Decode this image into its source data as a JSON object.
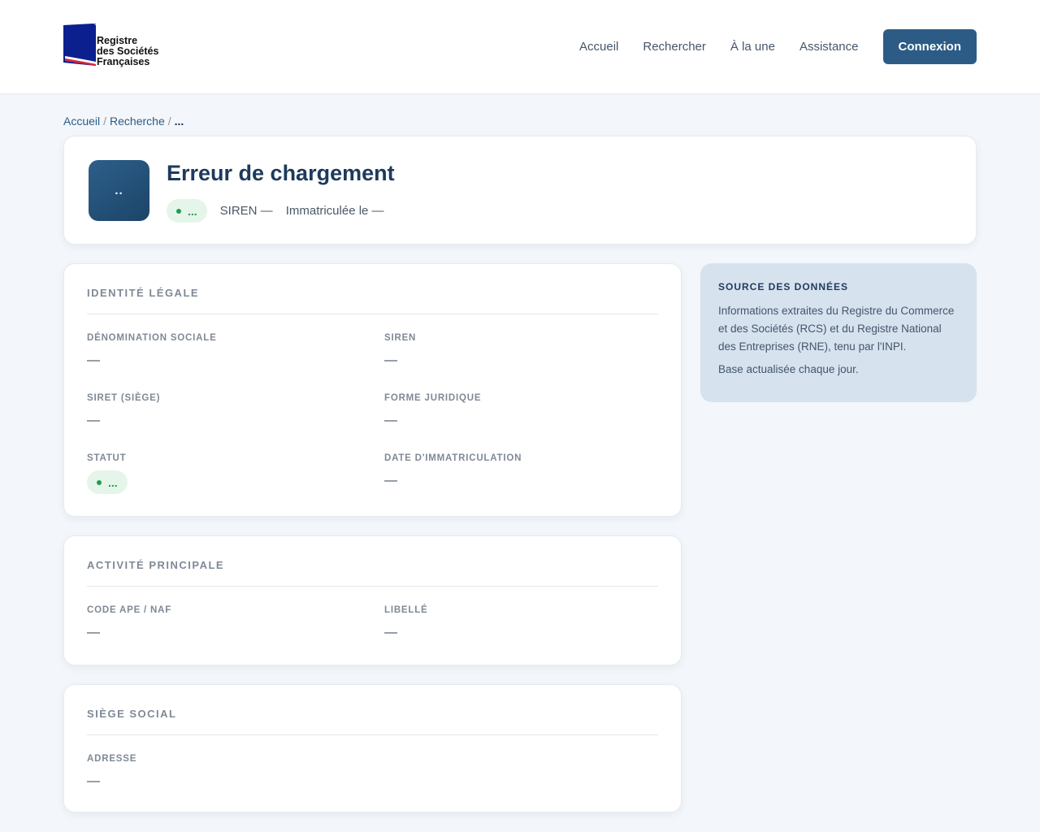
{
  "header": {
    "logo_lines": [
      "Registre",
      "des Sociétés",
      "Françaises"
    ],
    "nav": [
      "Accueil",
      "Rechercher",
      "À la une",
      "Assistance"
    ],
    "login_label": "Connexion",
    "colors": {
      "accent": "#2c5c85",
      "flag_blue": "#0b1f8f",
      "flag_red": "#d42a3a"
    }
  },
  "breadcrumb": {
    "items": [
      "Accueil",
      "Recherche"
    ],
    "separator": "/",
    "current": "..."
  },
  "hero": {
    "avatar_initials": "..",
    "title": "Erreur de chargement",
    "status_pill": "...",
    "siren_label": "SIREN —",
    "immat_label": "Immatriculée le —"
  },
  "identity": {
    "title": "IDENTITÉ LÉGALE",
    "fields": [
      {
        "label": "DÉNOMINATION SOCIALE",
        "value": "—"
      },
      {
        "label": "SIREN",
        "value": "—"
      },
      {
        "label": "SIRET (SIÈGE)",
        "value": "—"
      },
      {
        "label": "FORME JURIDIQUE",
        "value": "—"
      },
      {
        "label": "STATUT",
        "value": "..."
      },
      {
        "label": "DATE D'IMMATRICULATION",
        "value": "—"
      }
    ]
  },
  "activity": {
    "title": "ACTIVITÉ PRINCIPALE",
    "fields": [
      {
        "label": "CODE APE / NAF",
        "value": "—"
      },
      {
        "label": "LIBELLÉ",
        "value": "—"
      }
    ]
  },
  "seat": {
    "title": "SIÈGE SOCIAL",
    "fields": [
      {
        "label": "ADRESSE",
        "value": "—"
      }
    ]
  },
  "source": {
    "title": "SOURCE DES DONNÉES",
    "text": "Informations extraites du Registre du Commerce et des Sociétés (RCS) et du Registre National des Entreprises (RNE), tenu par l'INPI.",
    "update": "Base actualisée chaque jour."
  },
  "status_color": "#1e9e4e"
}
